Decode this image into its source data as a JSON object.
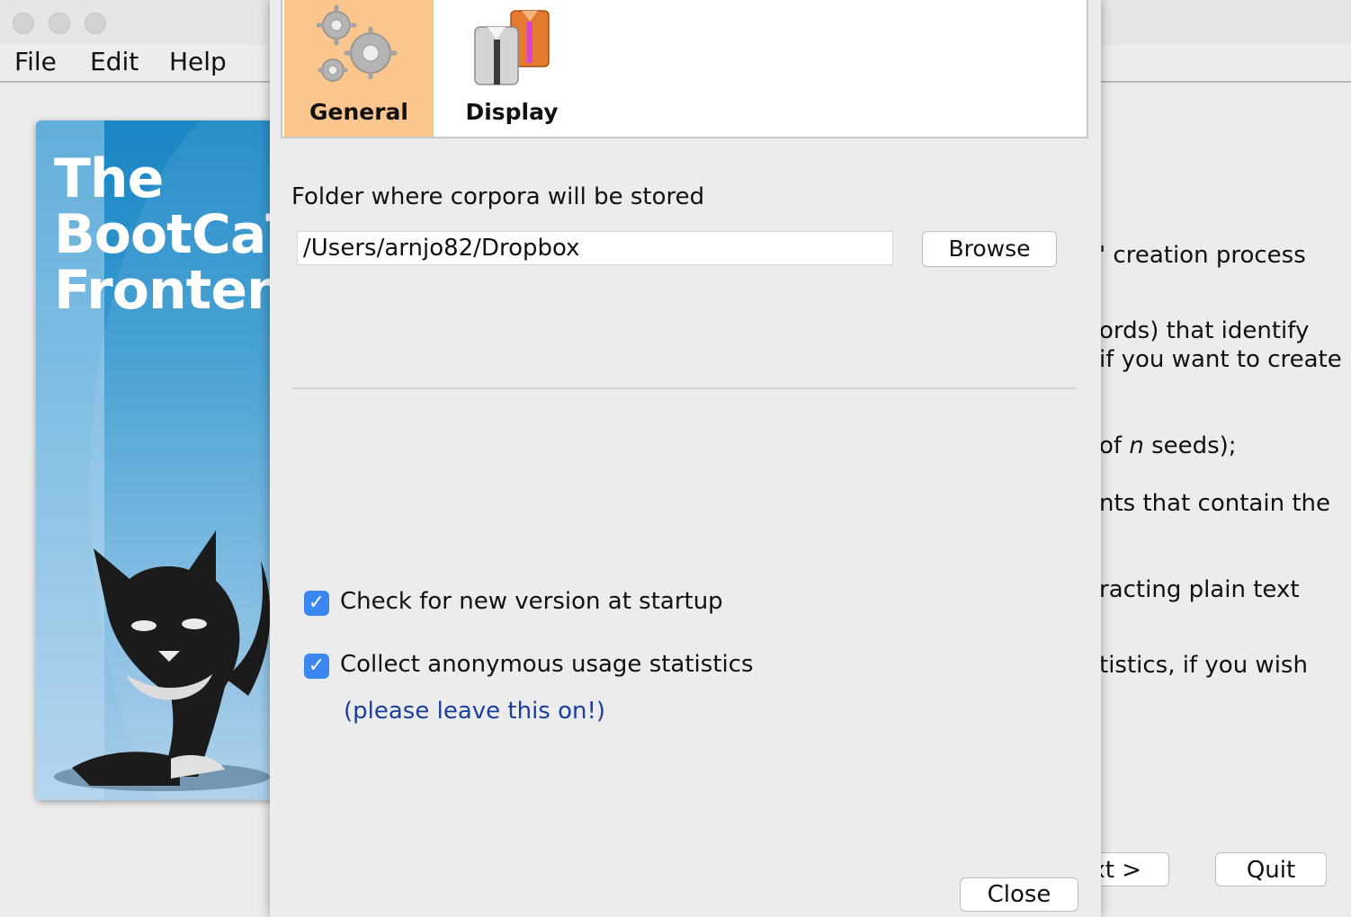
{
  "menu": {
    "file": "File",
    "edit": "Edit",
    "help": "Help"
  },
  "splash": {
    "title": "The\nBootCaT\nFrontend"
  },
  "background_text": {
    "line1": "' creation process",
    "line2": "ords) that identify",
    "line3": "if you want to create",
    "line4_prefix": "of ",
    "line4_italic": "n",
    "line4_suffix": " seeds);",
    "line5": "nts that contain the",
    "line6": "racting plain text",
    "line7": "tistics, if you wish",
    "next_button": "xt >",
    "quit_button": "Quit"
  },
  "dialog": {
    "tabs": [
      {
        "label": "General",
        "icon": "gears-icon",
        "active": true
      },
      {
        "label": "Display",
        "icon": "shirts-icon",
        "active": false
      }
    ],
    "folder_label": "Folder where corpora will be stored",
    "folder_value": "/Users/arnjo82/Dropbox",
    "browse_button": "Browse",
    "check_updates": {
      "label": "Check for new version at startup",
      "checked": true
    },
    "collect_stats": {
      "label": "Collect anonymous usage statistics",
      "checked": true
    },
    "stats_hint": "(please leave this on!)",
    "close_button": "Close"
  },
  "colors": {
    "active_tab": "#fbc68e",
    "checkbox": "#3a87f2",
    "hint_text": "#1b3fa0"
  }
}
